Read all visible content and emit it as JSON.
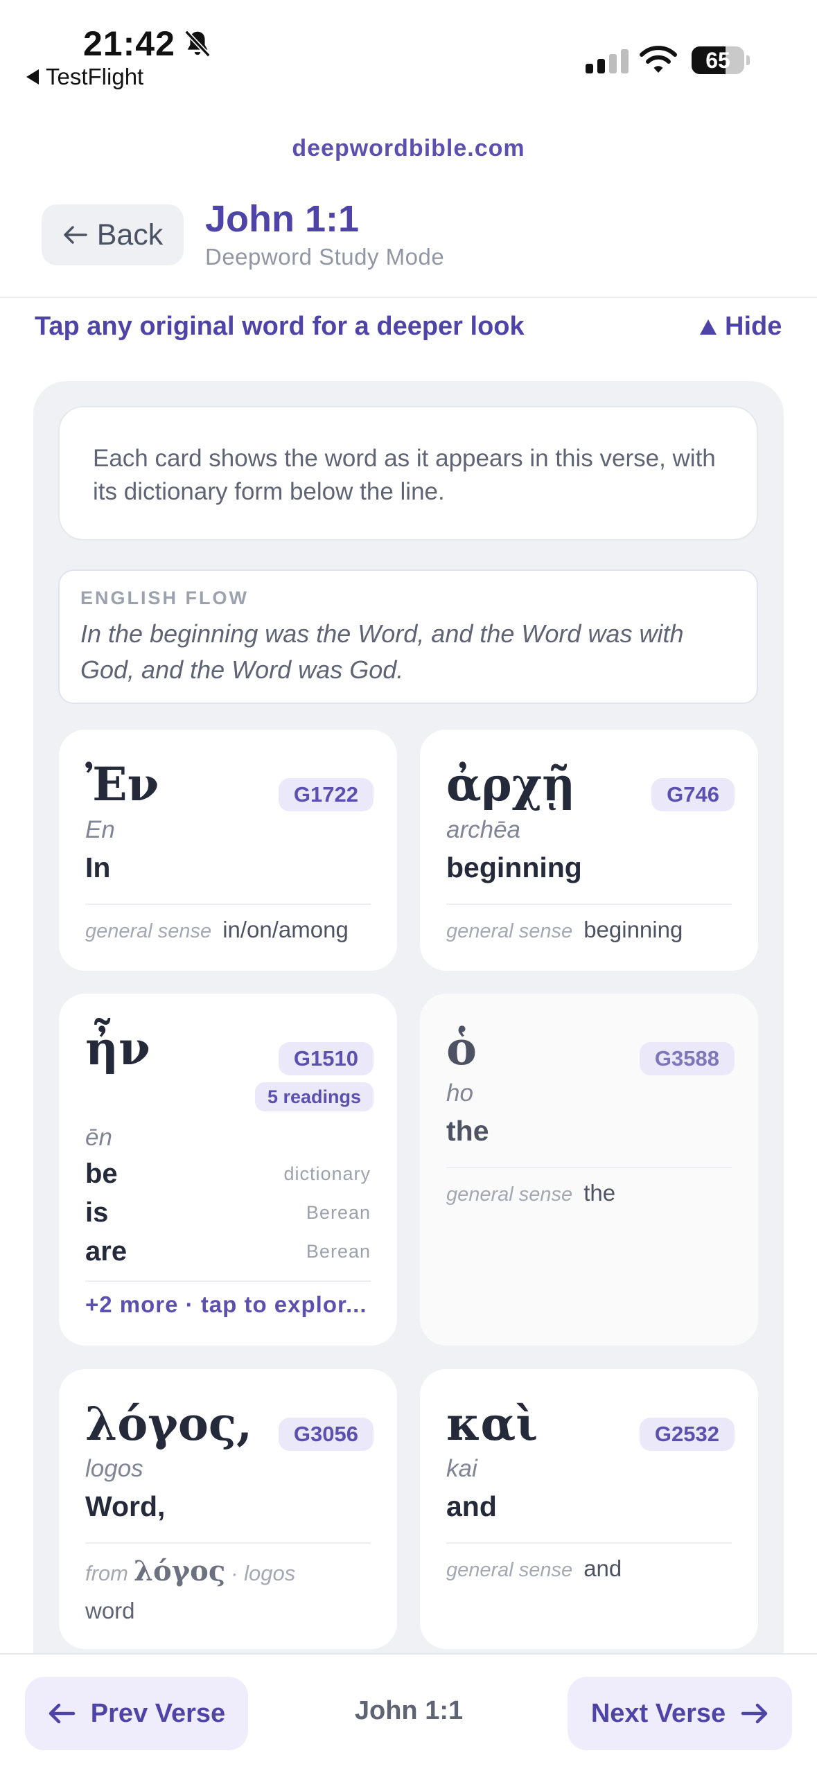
{
  "status_bar": {
    "time": "21:42",
    "back_app": "TestFlight",
    "battery": "65",
    "battery_level": 0.65
  },
  "header": {
    "site": "deepwordbible.com",
    "back_label": "Back",
    "title": "John 1:1",
    "subtitle": "Deepword Study Mode"
  },
  "hint": {
    "text": "Tap any original word for a deeper look",
    "toggle": "Hide"
  },
  "intro": "Each card shows the word as it appears in this verse, with its dictionary form below the line.",
  "english_flow": {
    "label": "ENGLISH FLOW",
    "text": "In the beginning was the Word, and the Word was with God, and the Word was God."
  },
  "sense_label": "general sense",
  "cards": [
    {
      "greek": "Ἐν",
      "code": "G1722",
      "translit": "En",
      "gloss": "In",
      "sense": "in/on/among"
    },
    {
      "greek": "ἀρχῇ",
      "code": "G746",
      "translit": "archēa",
      "gloss": "beginning",
      "sense": "beginning"
    },
    {
      "greek": "ἦν",
      "code": "G1510",
      "readings": "5 readings",
      "translit": "ēn",
      "rows": [
        {
          "word": "be",
          "source": "dictionary"
        },
        {
          "word": "is",
          "source": "Berean"
        },
        {
          "word": "are",
          "source": "Berean"
        }
      ],
      "more": "+2 more · tap to explor..."
    },
    {
      "greek": "ὁ",
      "code": "G3588",
      "translit": "ho",
      "gloss": "the",
      "sense": "the"
    },
    {
      "greek": "λόγος,",
      "code": "G3056",
      "translit": "logos",
      "gloss": "Word,",
      "from_label": "from",
      "lemma": "λόγος",
      "lemma_translit": "· logos",
      "lemma_gloss": "word"
    },
    {
      "greek": "καὶ",
      "code": "G2532",
      "translit": "kai",
      "gloss": "and",
      "sense": "and"
    }
  ],
  "nav": {
    "prev": "Prev Verse",
    "current": "John 1:1",
    "next": "Next Verse"
  },
  "colors": {
    "accent": "#4e44a8",
    "badge_bg": "#ebe8fa",
    "panel_bg": "#f0f1f4"
  }
}
